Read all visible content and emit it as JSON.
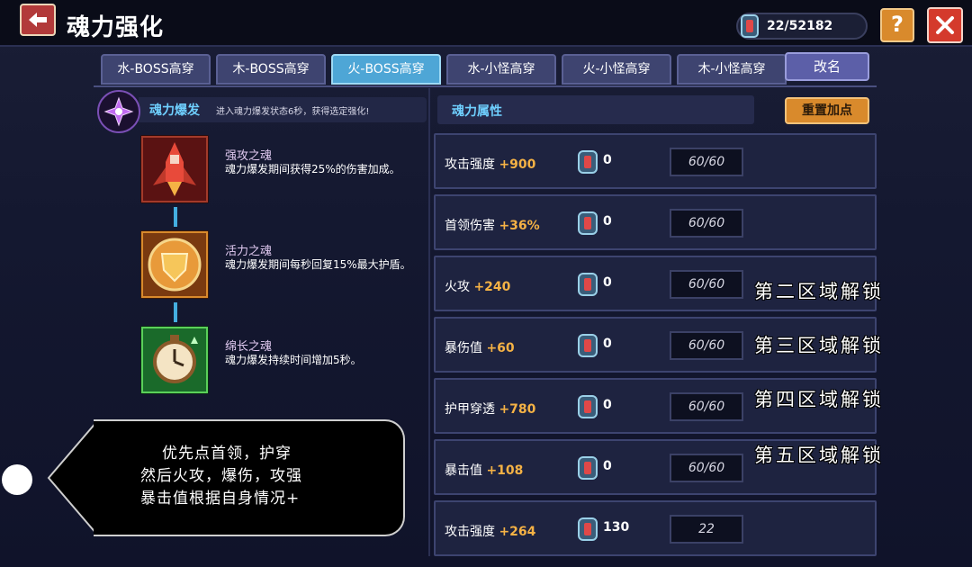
{
  "header": {
    "title": "魂力强化",
    "currency_value": "22/52182",
    "help_label": "?"
  },
  "tabs": [
    {
      "label": "水-BOSS高穿",
      "active": false
    },
    {
      "label": "木-BOSS高穿",
      "active": false
    },
    {
      "label": "火-BOSS高穿",
      "active": true
    },
    {
      "label": "水-小怪高穿",
      "active": false
    },
    {
      "label": "火-小怪高穿",
      "active": false
    },
    {
      "label": "木-小怪高穿",
      "active": false
    }
  ],
  "rename_label": "改名",
  "burst": {
    "title": "魂力爆发",
    "desc": "进入魂力爆发状态6秒，获得选定强化!"
  },
  "skills": [
    {
      "name": "强攻之魂",
      "desc": "魂力爆发期间获得25%的伤害加成。",
      "icon": "red-rocket-icon"
    },
    {
      "name": "活力之魂",
      "desc": "魂力爆发期间每秒回复15%最大护盾。",
      "icon": "golden-shield-icon"
    },
    {
      "name": "绵长之魂",
      "desc": "魂力爆发持续时间增加5秒。",
      "icon": "green-clock-icon"
    }
  ],
  "annotation": {
    "lines": [
      "优先点首领，护穿",
      "然后火攻，爆伤，攻强",
      "暴击值根据自身情况+"
    ]
  },
  "attributes_header": "魂力属性",
  "reset_label": "重置加点",
  "attributes": [
    {
      "name": "攻击强度",
      "bonus": "+900",
      "count": "0",
      "level": "60/60"
    },
    {
      "name": "首领伤害",
      "bonus": "+36%",
      "count": "0",
      "level": "60/60"
    },
    {
      "name": "火攻",
      "bonus": "+240",
      "count": "0",
      "level": "60/60"
    },
    {
      "name": "暴伤值",
      "bonus": "+60",
      "count": "0",
      "level": "60/60"
    },
    {
      "name": "护甲穿透",
      "bonus": "+780",
      "count": "0",
      "level": "60/60"
    },
    {
      "name": "暴击值",
      "bonus": "+108",
      "count": "0",
      "level": "60/60"
    },
    {
      "name": "攻击强度",
      "bonus": "+264",
      "count": "130",
      "level": "22"
    }
  ],
  "unlock_notes": [
    "第二区域解锁",
    "第三区域解锁",
    "第四区域解锁",
    "第五区域解锁"
  ],
  "colors": {
    "active_tab": "#4ea6d6",
    "bonus": "#f5b245",
    "accent_blue": "#6fd0ff",
    "close_red": "#d43a2c",
    "help_orange": "#d98a2c"
  }
}
